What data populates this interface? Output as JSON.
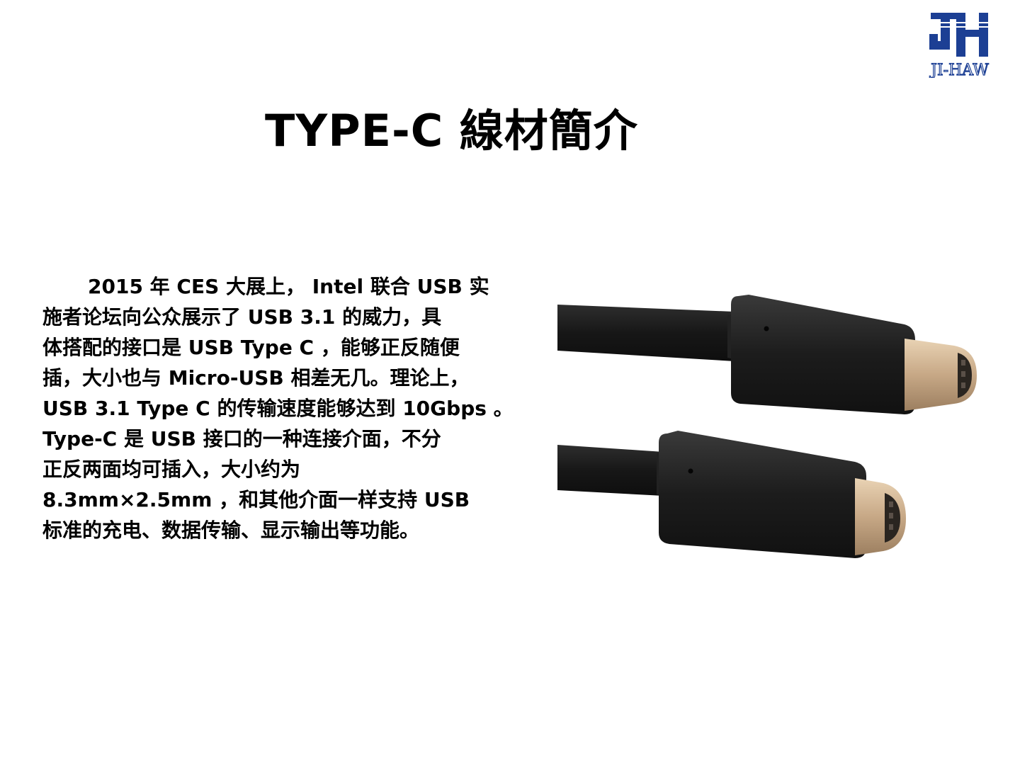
{
  "logo": {
    "mark": "JH",
    "wordmark": "JI-HAW",
    "color": "#1c3f94"
  },
  "slide": {
    "title": "TYPE-C 線材簡介",
    "paragraph_lines": [
      "2015 年 CES 大展上， Intel 联合 USB 实",
      "施者论坛向公众展示了 USB 3.1 的威力，具",
      "体搭配的接口是 USB Type C ，能够正反随便",
      "插，大小也与 Micro-USB 相差无几。理论上，",
      "USB 3.1 Type C 的传输速度能够达到 10Gbps 。",
      "Type-C 是 USB 接口的一种连接介面，不分",
      "正反两面均可插入，大小约为",
      "8.3mm×2.5mm ，和其他介面一样支持 USB",
      "标准的充电、数据传输、显示输出等功能。"
    ]
  },
  "image": {
    "subject": "usb-type-c-cable-connectors-icon",
    "colors": {
      "cable": "#1b1b1b",
      "plug": "#cdb08e"
    }
  }
}
